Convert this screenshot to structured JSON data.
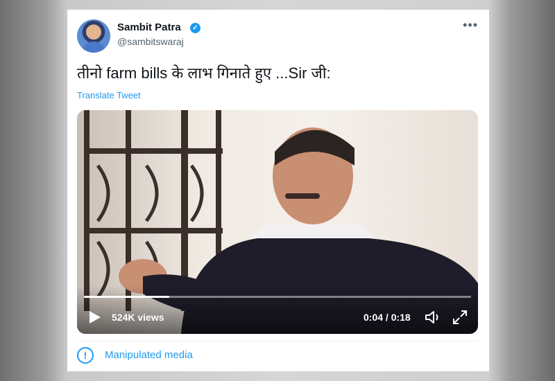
{
  "tweet": {
    "author_name": "Sambit Patra",
    "author_handle": "@sambitswaraj",
    "text": "तीनो farm bills के लाभ गिनाते हुए ...Sir जी:",
    "translate_label": "Translate Tweet",
    "more_label": "•••"
  },
  "video": {
    "views": "524K views",
    "time": "0:04 / 0:18",
    "progress": 0.22
  },
  "label": {
    "text": "Manipulated media",
    "icon_glyph": "!"
  },
  "icons": [
    "verified-badge-icon",
    "more-icon",
    "play-icon",
    "volume-icon",
    "fullscreen-icon",
    "info-icon"
  ],
  "colors": {
    "accent": "#1d9bf0",
    "text": "#0f1419",
    "secondary": "#536471"
  }
}
